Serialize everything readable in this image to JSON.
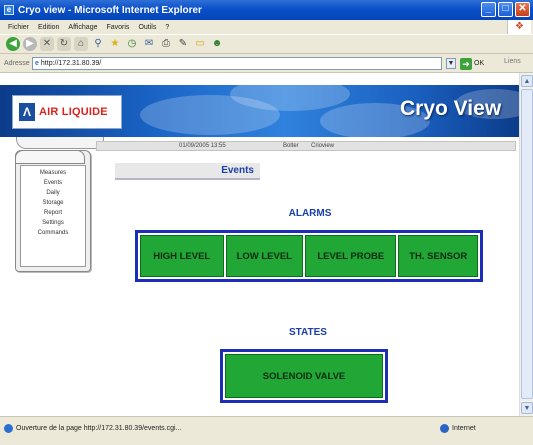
{
  "window": {
    "title": "Cryo view - Microsoft Internet Explorer",
    "buttons": {
      "minimize": "_",
      "maximize": "□",
      "close": "✕"
    }
  },
  "menubar": {
    "items": [
      "Fichier",
      "Edition",
      "Affichage",
      "Favoris",
      "Outils",
      "?"
    ]
  },
  "address": {
    "label": "Adresse",
    "url": "http://172.31.80.39/",
    "go_label": "OK",
    "links_label": "Liens"
  },
  "banner": {
    "logo_text": "AIR LIQUIDE",
    "app_title": "Cryo View"
  },
  "infobar": {
    "datetime": "01/09/2005 13:55",
    "user": "Bolter",
    "site": "Crioview"
  },
  "sidemenu": {
    "items": [
      "Measures",
      "Events",
      "Daily",
      "Storage",
      "Report",
      "Settings",
      "Commands"
    ]
  },
  "section_title": "Events",
  "alarms": {
    "label": "ALARMS",
    "items": [
      "HIGH LEVEL",
      "LOW LEVEL",
      "LEVEL PROBE",
      "TH. SENSOR"
    ]
  },
  "states": {
    "label": "STATES",
    "items": [
      "SOLENOID VALVE"
    ]
  },
  "statusbar": {
    "text": "Ouverture de la page http://172.31.80.39/events.cgi...",
    "zone": "Internet"
  },
  "colors": {
    "tile_green": "#21a735",
    "frame_blue": "#1a2fb5",
    "label_blue": "#1b3fa8",
    "brand_red": "#d9241c"
  }
}
